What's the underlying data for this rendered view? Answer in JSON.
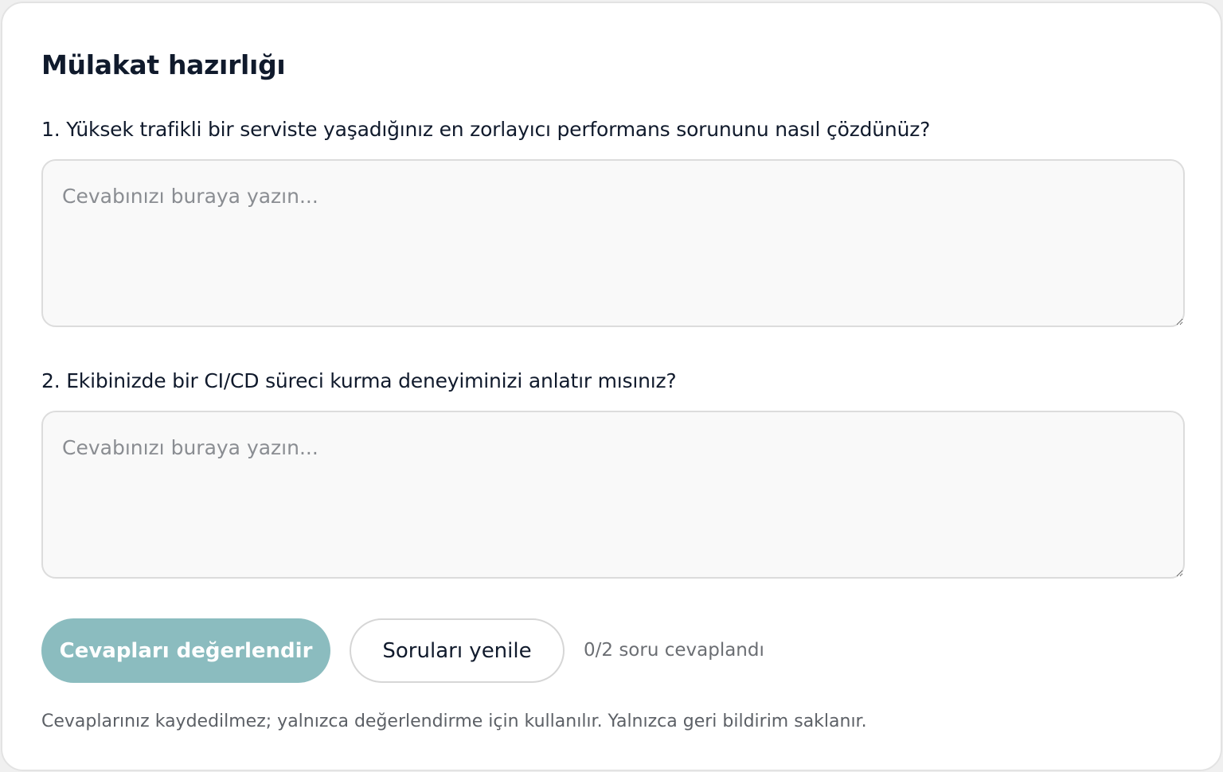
{
  "page": {
    "title": "Mülakat hazırlığı"
  },
  "questions": [
    {
      "label": "1. Yüksek trafikli bir serviste yaşadığınız en zorlayıcı performans sorununu nasıl çözdünüz?",
      "answer_value": "",
      "answer_placeholder": "Cevabınızı buraya yazın..."
    },
    {
      "label": "2. Ekibinizde bir CI/CD süreci kurma deneyiminizi anlatır mısınız?",
      "answer_value": "",
      "answer_placeholder": "Cevabınızı buraya yazın..."
    }
  ],
  "actions": {
    "evaluate_label": "Cevapları değerlendir",
    "refresh_label": "Soruları yenile",
    "progress_text": "0/2 soru cevaplandı"
  },
  "footnote": "Cevaplarınız kaydedilmez; yalnızca değerlendirme için kullanılır. Yalnızca geri bildirim saklanır.",
  "colors": {
    "primary_button": "#8bbcbf",
    "text_dark": "#101a2c",
    "muted_text": "#6b6e73"
  }
}
